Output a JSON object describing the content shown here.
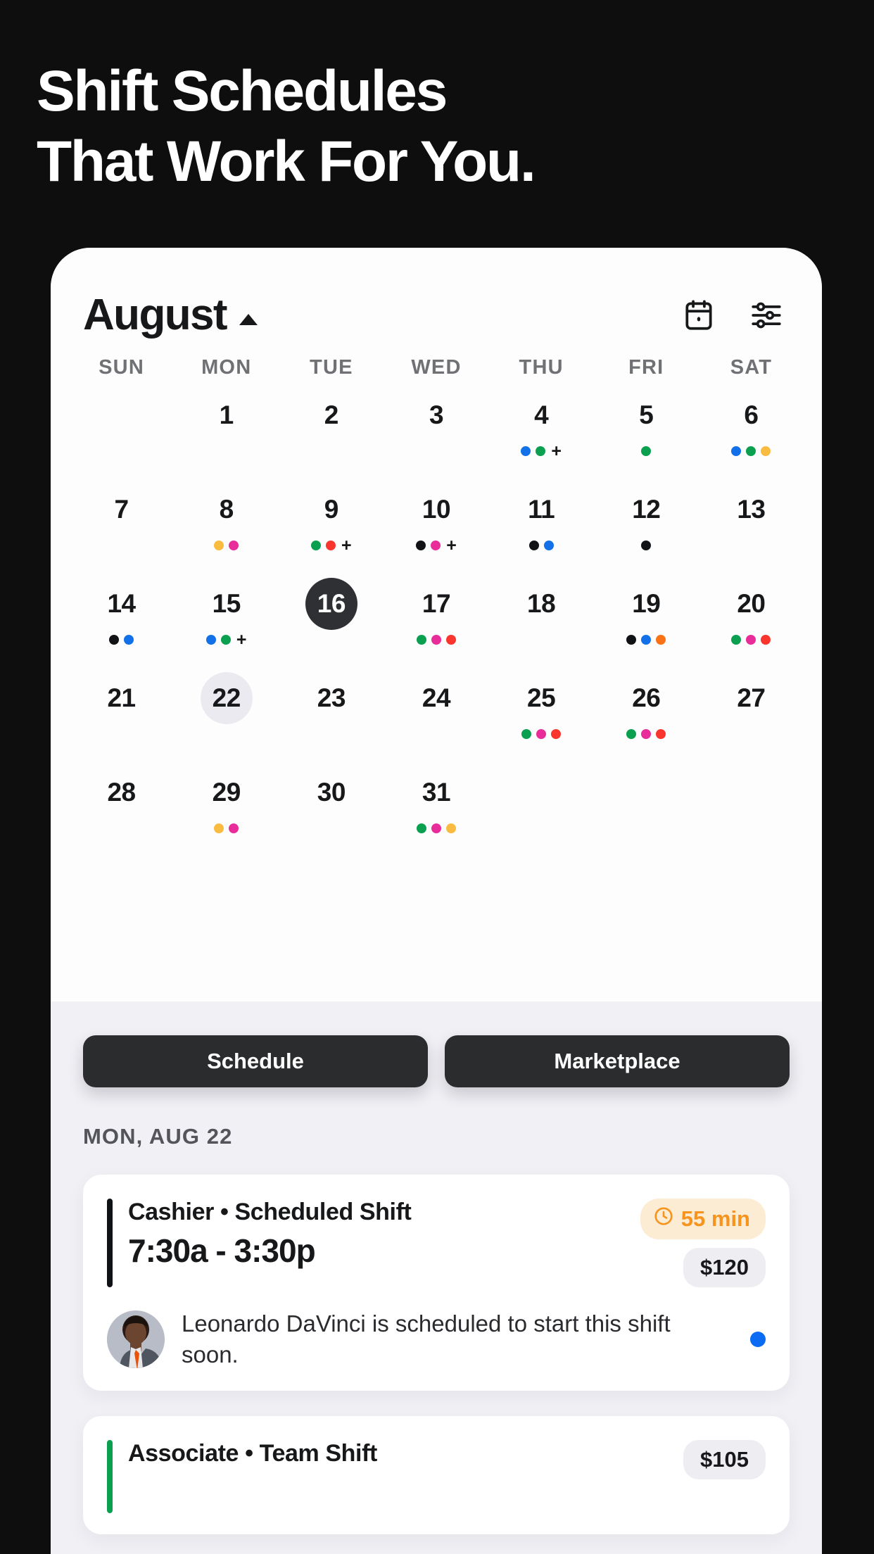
{
  "headline": {
    "line1": "Shift Schedules",
    "line2": "That Work For You."
  },
  "colors": {
    "background": "#0e0e0f",
    "panel": "#f1f0f5",
    "card": "#ffffff",
    "ink": "#17181a",
    "green": "#0aa04f",
    "pink": "#e82c9a",
    "red": "#f9352e",
    "blue": "#1271e8",
    "yellow": "#f9bc40",
    "orange": "#f97316",
    "black": "#111215",
    "accent_blue": "#0b6bf2",
    "badge_orange": "#f7941e"
  },
  "calendar": {
    "month": "August",
    "caret": "caret-up-icon",
    "icons": [
      "calendar-icon",
      "filters-icon"
    ],
    "weekdays": [
      "SUN",
      "MON",
      "TUE",
      "WED",
      "THU",
      "FRI",
      "SAT"
    ],
    "weeks": [
      [
        {
          "day": "",
          "dots": []
        },
        {
          "day": "1",
          "dots": []
        },
        {
          "day": "2",
          "dots": []
        },
        {
          "day": "3",
          "dots": []
        },
        {
          "day": "4",
          "dots": [
            "blue",
            "green"
          ],
          "more": "+"
        },
        {
          "day": "5",
          "dots": [
            "green"
          ]
        },
        {
          "day": "6",
          "dots": [
            "blue",
            "green",
            "yellow"
          ]
        }
      ],
      [
        {
          "day": "7",
          "dots": []
        },
        {
          "day": "8",
          "dots": [
            "yellow",
            "pink"
          ]
        },
        {
          "day": "9",
          "dots": [
            "green",
            "red"
          ],
          "more": "+"
        },
        {
          "day": "10",
          "dots": [
            "black",
            "pink"
          ],
          "more": "+"
        },
        {
          "day": "11",
          "dots": [
            "black",
            "blue"
          ]
        },
        {
          "day": "12",
          "dots": [
            "black"
          ]
        },
        {
          "day": "13",
          "dots": []
        }
      ],
      [
        {
          "day": "14",
          "dots": [
            "black",
            "blue"
          ]
        },
        {
          "day": "15",
          "dots": [
            "blue",
            "green"
          ],
          "more": "+"
        },
        {
          "day": "16",
          "dots": [],
          "state": "selected"
        },
        {
          "day": "17",
          "dots": [
            "green",
            "pink",
            "red"
          ]
        },
        {
          "day": "18",
          "dots": []
        },
        {
          "day": "19",
          "dots": [
            "black",
            "blue",
            "orange"
          ]
        },
        {
          "day": "20",
          "dots": [
            "green",
            "pink",
            "red"
          ]
        }
      ],
      [
        {
          "day": "21",
          "dots": []
        },
        {
          "day": "22",
          "dots": [],
          "state": "today"
        },
        {
          "day": "23",
          "dots": []
        },
        {
          "day": "24",
          "dots": []
        },
        {
          "day": "25",
          "dots": [
            "green",
            "pink",
            "red"
          ]
        },
        {
          "day": "26",
          "dots": [
            "green",
            "pink",
            "red"
          ]
        },
        {
          "day": "27",
          "dots": []
        }
      ],
      [
        {
          "day": "28",
          "dots": []
        },
        {
          "day": "29",
          "dots": [
            "yellow",
            "pink"
          ]
        },
        {
          "day": "30",
          "dots": []
        },
        {
          "day": "31",
          "dots": [
            "green",
            "pink",
            "yellow"
          ]
        },
        {
          "day": "",
          "dots": []
        },
        {
          "day": "",
          "dots": []
        },
        {
          "day": "",
          "dots": []
        }
      ]
    ]
  },
  "tabs": [
    {
      "label": "Schedule"
    },
    {
      "label": "Marketplace"
    }
  ],
  "day_label": "MON, AUG 22",
  "shifts": [
    {
      "accent": "#111215",
      "role": "Cashier • Scheduled Shift",
      "time": "7:30a - 3:30p",
      "duration": "55 min",
      "duration_icon": "clock-icon",
      "pay": "$120",
      "note": "Leonardo DaVinci is scheduled to start this shift soon.",
      "avatar": "avatar",
      "status_dot": "#0b6bf2"
    },
    {
      "accent": "#0aa04f",
      "role": "Associate • Team Shift",
      "pay": "$105"
    }
  ]
}
